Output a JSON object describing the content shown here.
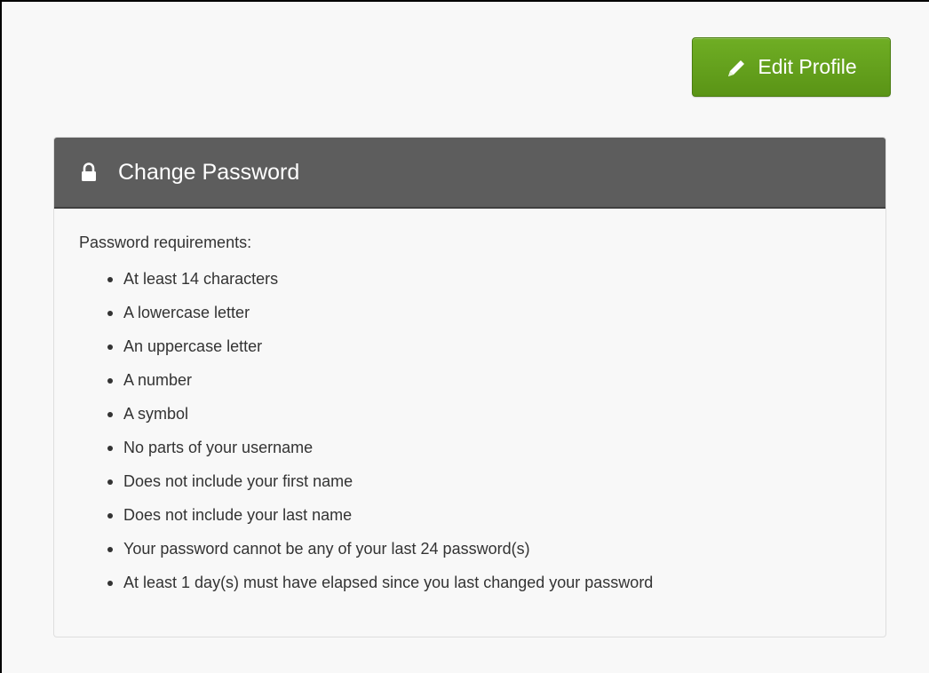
{
  "actions": {
    "edit_profile_label": "Edit Profile",
    "edit_profile_icon": "pencil-icon",
    "button_color": "#62a11c"
  },
  "change_password": {
    "title": "Change Password",
    "icon": "lock-icon",
    "header_color": "#5d5d5d",
    "intro": "Password requirements:",
    "requirements": [
      "At least 14 characters",
      "A lowercase letter",
      "An uppercase letter",
      "A number",
      "A symbol",
      "No parts of your username",
      "Does not include your first name",
      "Does not include your last name",
      "Your password cannot be any of your last 24 password(s)",
      "At least 1 day(s) must have elapsed since you last changed your password"
    ]
  }
}
